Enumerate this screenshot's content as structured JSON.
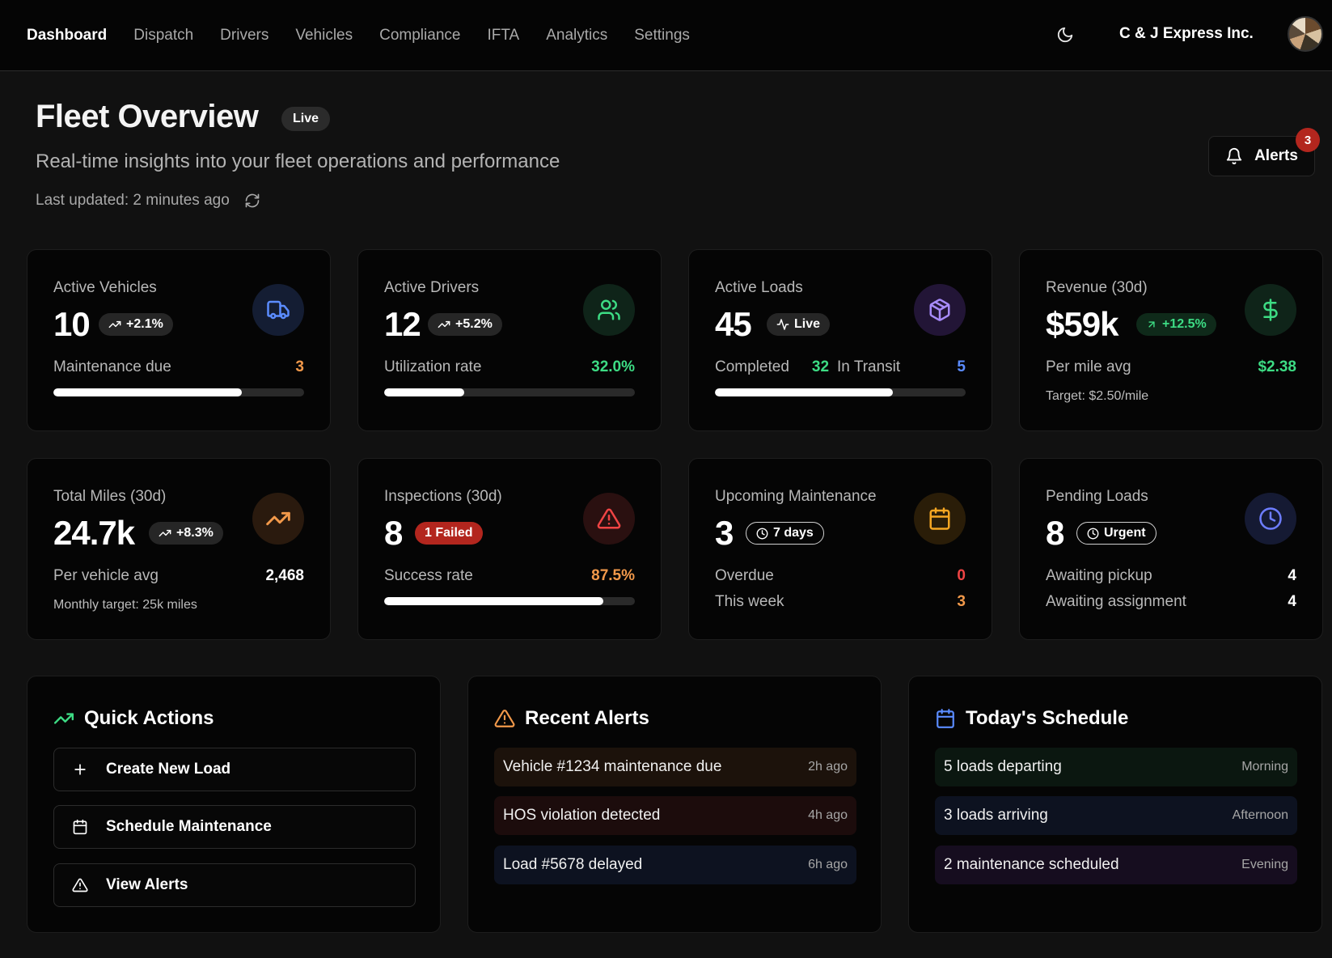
{
  "nav": {
    "links": [
      "Dashboard",
      "Dispatch",
      "Drivers",
      "Vehicles",
      "Compliance",
      "IFTA",
      "Analytics",
      "Settings"
    ],
    "active": "Dashboard",
    "company": "C & J Express Inc."
  },
  "header": {
    "title": "Fleet Overview",
    "live": "Live",
    "subtitle": "Real-time insights into your fleet operations and performance",
    "updated": "Last updated: 2 minutes ago",
    "alerts_label": "Alerts",
    "alerts_count": "3"
  },
  "cards": {
    "vehicles": {
      "label": "Active Vehicles",
      "value": "10",
      "delta": "+2.1%",
      "row_label": "Maintenance due",
      "row_value": "3",
      "progress": 0.75
    },
    "drivers": {
      "label": "Active Drivers",
      "value": "12",
      "delta": "+5.2%",
      "row_label": "Utilization rate",
      "row_value": "32.0%",
      "progress": 0.32
    },
    "loads": {
      "label": "Active Loads",
      "value": "45",
      "badge": "Live",
      "completed_label": "Completed",
      "completed_value": "32",
      "transit_label": "In Transit",
      "transit_value": "5",
      "progress": 0.71
    },
    "revenue": {
      "label": "Revenue (30d)",
      "value": "$59k",
      "delta": "+12.5%",
      "row_label": "Per mile avg",
      "row_value": "$2.38",
      "note": "Target: $2.50/mile"
    },
    "miles": {
      "label": "Total Miles (30d)",
      "value": "24.7k",
      "delta": "+8.3%",
      "row_label": "Per vehicle avg",
      "row_value": "2,468",
      "note": "Monthly target: 25k miles"
    },
    "inspections": {
      "label": "Inspections (30d)",
      "value": "8",
      "badge": "1 Failed",
      "row_label": "Success rate",
      "row_value": "87.5%",
      "progress": 0.875
    },
    "maintenance": {
      "label": "Upcoming Maintenance",
      "value": "3",
      "badge": "7 days",
      "row1_label": "Overdue",
      "row1_value": "0",
      "row2_label": "This week",
      "row2_value": "3"
    },
    "pending": {
      "label": "Pending Loads",
      "value": "8",
      "badge": "Urgent",
      "row1_label": "Awaiting pickup",
      "row1_value": "4",
      "row2_label": "Awaiting assignment",
      "row2_value": "4"
    }
  },
  "quick_actions": {
    "title": "Quick Actions",
    "items": [
      "Create New Load",
      "Schedule Maintenance",
      "View Alerts"
    ]
  },
  "recent_alerts": {
    "title": "Recent Alerts",
    "items": [
      {
        "text": "Vehicle #1234 maintenance due",
        "time": "2h ago"
      },
      {
        "text": "HOS violation detected",
        "time": "4h ago"
      },
      {
        "text": "Load #5678 delayed",
        "time": "6h ago"
      }
    ]
  },
  "schedule": {
    "title": "Today's Schedule",
    "items": [
      {
        "text": "5 loads departing",
        "time": "Morning"
      },
      {
        "text": "3 loads arriving",
        "time": "Afternoon"
      },
      {
        "text": "2 maintenance scheduled",
        "time": "Evening"
      }
    ]
  },
  "colors": {
    "green": "#3ddc84",
    "orange": "#f2994a",
    "red": "#ef4444",
    "blue": "#5b8cff",
    "purple": "#a78bfa"
  }
}
